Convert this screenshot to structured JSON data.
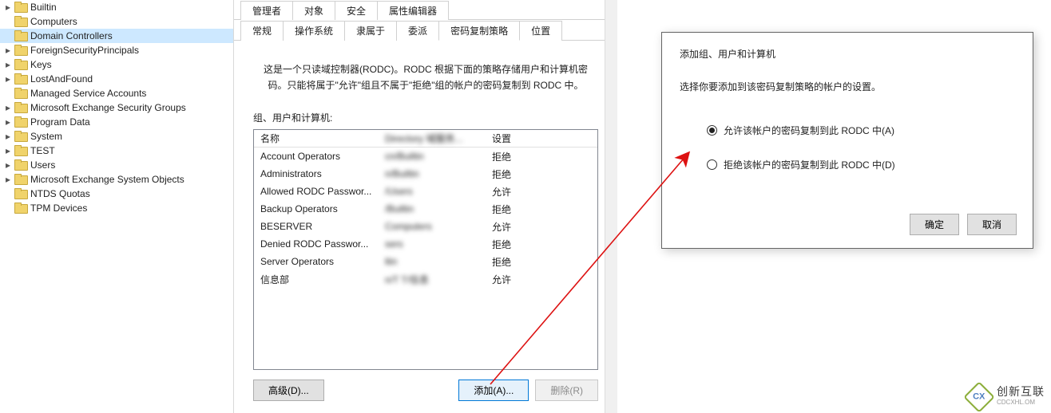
{
  "tree": [
    {
      "label": "Builtin",
      "caret": "right",
      "selected": false
    },
    {
      "label": "Computers",
      "caret": "none",
      "selected": false
    },
    {
      "label": "Domain Controllers",
      "caret": "none",
      "selected": true
    },
    {
      "label": "ForeignSecurityPrincipals",
      "caret": "right",
      "selected": false
    },
    {
      "label": "Keys",
      "caret": "right",
      "selected": false
    },
    {
      "label": "LostAndFound",
      "caret": "right",
      "selected": false
    },
    {
      "label": "Managed Service Accounts",
      "caret": "none",
      "selected": false
    },
    {
      "label": "Microsoft Exchange Security Groups",
      "caret": "right",
      "selected": false
    },
    {
      "label": "Program Data",
      "caret": "right",
      "selected": false
    },
    {
      "label": "System",
      "caret": "right",
      "selected": false
    },
    {
      "label": "TEST",
      "caret": "right",
      "selected": false
    },
    {
      "label": "Users",
      "caret": "right",
      "selected": false
    },
    {
      "label": "Microsoft Exchange System Objects",
      "caret": "right",
      "selected": false
    },
    {
      "label": "NTDS Quotas",
      "caret": "none",
      "selected": false
    },
    {
      "label": "TPM Devices",
      "caret": "none",
      "selected": false
    }
  ],
  "tabs_row1": [
    "管理者",
    "对象",
    "安全",
    "属性编辑器"
  ],
  "tabs_row2": [
    "常规",
    "操作系统",
    "隶属于",
    "委派",
    "密码复制策略",
    "位置"
  ],
  "active_tab": "密码复制策略",
  "desc_line1": "这是一个只读域控制器(RODC)。RODC 根据下面的策略存储用户和计算机密",
  "desc_line2": "码。只能将属于\"允许\"组且不属于\"拒绝\"组的帐户的密码复制到 RODC 中。",
  "section_label": "组、用户和计算机:",
  "columns": {
    "name": "名称",
    "dir": "Directory 域服务...",
    "set": "设置"
  },
  "rows": [
    {
      "name": "Account Operators",
      "dir": "cn/Builtin",
      "set": "拒绝"
    },
    {
      "name": "Administrators",
      "dir": "n/Builtin",
      "set": "拒绝"
    },
    {
      "name": "Allowed RODC Passwor...",
      "dir": "/Users",
      "set": "允许"
    },
    {
      "name": "Backup Operators",
      "dir": "/Builtin",
      "set": "拒绝"
    },
    {
      "name": "BESERVER",
      "dir": "Computers",
      "set": "允许"
    },
    {
      "name": "Denied RODC Passwor...",
      "dir": "sers",
      "set": "拒绝"
    },
    {
      "name": "Server Operators",
      "dir": "ltin",
      "set": "拒绝"
    },
    {
      "name": "信息部",
      "dir": "n/T    T/信息",
      "set": "允许"
    }
  ],
  "buttons": {
    "advanced": "高级(D)...",
    "add": "添加(A)...",
    "remove": "删除(R)"
  },
  "dialog": {
    "title": "添加组、用户和计算机",
    "subtitle": "选择你要添加到该密码复制策略的帐户的设置。",
    "opt_allow": "允许该帐户的密码复制到此 RODC 中(A)",
    "opt_deny": "拒绝该帐户的密码复制到此 RODC 中(D)",
    "ok": "确定",
    "cancel": "取消",
    "selected": "allow"
  },
  "watermark": {
    "logo": "CX",
    "cn": "创新互联",
    "en": "CDCXHL.OM"
  }
}
